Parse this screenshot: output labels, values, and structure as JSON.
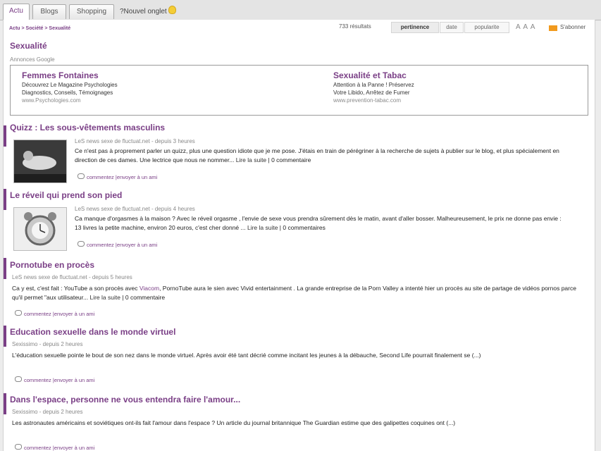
{
  "tabs": [
    {
      "label": "Actu"
    },
    {
      "label": "Blogs"
    },
    {
      "label": "Shopping"
    }
  ],
  "new_link": "?Nouvel onglet",
  "breadcrumb": "Actu > Société > Sexualité",
  "results_count": "733 résultats",
  "sort": {
    "pertinence": "pertinence",
    "date": "date",
    "popularite": "popularite"
  },
  "text_size": "A A A",
  "subscribe": "S'abonner",
  "category_title": "Sexualité",
  "ads_label": "Annonces Google",
  "ads": [
    {
      "title": "Femmes Fontaines",
      "line1": "Découvrez Le Magazine Psychologies",
      "line2": "Diagnostics, Conseils, Témoignages",
      "url": "www.Psychologies.com"
    },
    {
      "title": "Sexualité et Tabac",
      "line1": "Attention à la Panne ! Préservez",
      "line2": "Votre Libido, Arrêtez de Fumer",
      "url": "www.prevention-tabac.com"
    }
  ],
  "actions": {
    "comment": "commentez",
    "separator": "|",
    "send": "envoyer à un ami"
  },
  "read_more": "Lire la suite",
  "articles": [
    {
      "title": "Quizz : Les sous-vêtements masculins",
      "source": "LeS news sexe de fluctuat.net - depuis 3 heures",
      "text": "Ce n'est pas à proprement parler un quizz, plus une question idiote que je me pose. J'étais en train de pérégriner à la recherche de sujets à publier sur le blog, et plus spécialement en direction de ces dames. Une lectrice que nous ne nommer...",
      "comments": "0 commentaire"
    },
    {
      "title": "Le réveil qui prend son pied",
      "source": "LeS news sexe de fluctuat.net - depuis 4 heures",
      "text": "Ca manque d'orgasmes à la maison ? Avec le réveil orgasme , l'envie de sexe vous prendra sûrement dès le matin, avant d'aller bosser. Malheureusement, le prix ne donne pas envie : 13 livres la petite machine, environ 20 euros, c'est cher donné ...",
      "comments": "0 commentaires"
    },
    {
      "title": "Pornotube en procès",
      "source": "LeS news sexe de fluctuat.net - depuis 5 heures",
      "text_pre": "Ca y est, c'est fait : YouTube a son procès avec ",
      "text_link": "Viacom",
      "text_post": ", PornoTube aura le sien avec Vivid entertainment . La grande entreprise de la Porn Valley a intenté hier un procès au site de partage de vidéos pornos parce qu'il permet \"aux utilisateur...",
      "comments": "0 commentaire"
    },
    {
      "title": "Education sexuelle dans le monde virtuel",
      "source": "Sexissimo - depuis 2 heures",
      "text": "L'éducation sexuelle pointe le bout de son nez dans le monde virtuel. Après avoir été tant décrié comme incitant les jeunes à la débauche, Second Life pourrait finalement se (...)"
    },
    {
      "title": "Dans l'espace, personne ne vous entendra faire l'amour...",
      "source": "Sexissimo - depuis 2 heures",
      "text": "Les astronautes américains et soviétiques ont-ils fait l'amour dans l'espace ? Un article du journal britannique The Guardian estime que des galipettes coquines ont (...)"
    }
  ],
  "colors": {
    "accent": "#7a3f86",
    "rss": "#f19a1d"
  }
}
